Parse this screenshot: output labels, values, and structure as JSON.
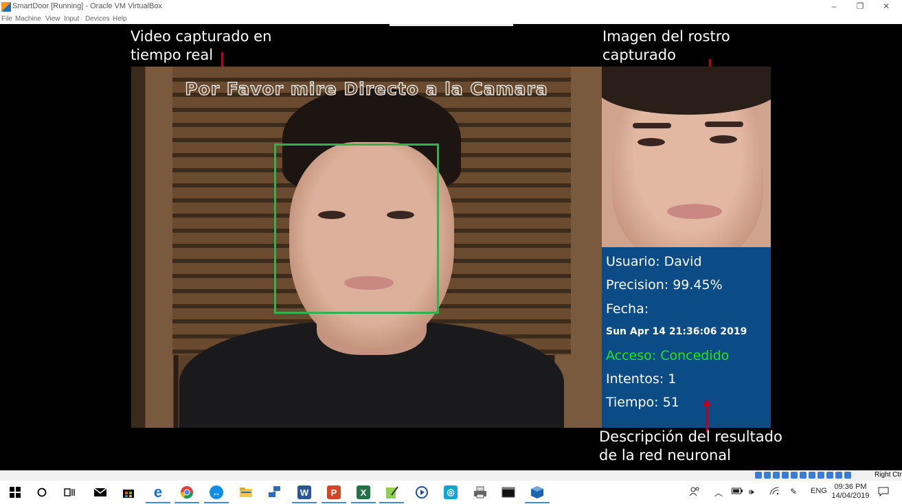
{
  "window": {
    "title": "SmartDoor [Running] - Oracle VM VirtualBox",
    "menu": [
      "File",
      "Machine",
      "View",
      "Input",
      "Devices",
      "Help"
    ],
    "controls": {
      "minimize": "–",
      "restore": "❐",
      "close": "✕"
    }
  },
  "video": {
    "overlay_text": "Por Favor mire Directo a la Camara",
    "face_box_color": "#2fb34a"
  },
  "result": {
    "usuario": "Usuario: David",
    "precision": "Precision: 99.45%",
    "fecha_label": "Fecha:",
    "fecha": "Sun Apr 14 21:36:06 2019",
    "acceso": "Acceso: Concedido",
    "intentos": "Intentos: 1",
    "tiempo": "Tiempo: 51",
    "panel_color": "#0b4c86",
    "access_color": "#1ee31e"
  },
  "annotations": {
    "video_line1": "Video capturado en",
    "video_line2": "tiempo real",
    "face_line1": "Imagen del rostro",
    "face_line2": "capturado",
    "result_line1": "Descripción del resultado",
    "result_line2": "de la red neuronal",
    "arrow_color": "#c0001a"
  },
  "vbox_status": {
    "host_key": "Right Ctrl"
  },
  "taskbar": {
    "apps": [
      {
        "name": "start",
        "icon": "windows-logo"
      },
      {
        "name": "search",
        "icon": "circle"
      },
      {
        "name": "task-view",
        "icon": "task-view"
      },
      {
        "name": "mail",
        "icon": "envelope"
      },
      {
        "name": "store",
        "icon": "shopping-bag"
      },
      {
        "name": "edge",
        "icon": "e"
      },
      {
        "name": "chrome",
        "icon": "chrome"
      },
      {
        "name": "teamviewer",
        "icon": "teamviewer"
      },
      {
        "name": "file-explorer",
        "icon": "folder"
      },
      {
        "name": "network",
        "icon": "network"
      },
      {
        "name": "word",
        "icon": "W"
      },
      {
        "name": "powerpoint",
        "icon": "P"
      },
      {
        "name": "excel",
        "icon": "X"
      },
      {
        "name": "notepad-plus",
        "icon": "notepad"
      },
      {
        "name": "media-player",
        "icon": "play"
      },
      {
        "name": "app-cyan",
        "icon": "cyan"
      },
      {
        "name": "printer",
        "icon": "printer"
      },
      {
        "name": "terminal",
        "icon": "terminal"
      },
      {
        "name": "virtualbox",
        "icon": "cube"
      }
    ],
    "tray": {
      "language": "ENG",
      "time": "09:36 PM",
      "date": "14/04/2019"
    }
  }
}
